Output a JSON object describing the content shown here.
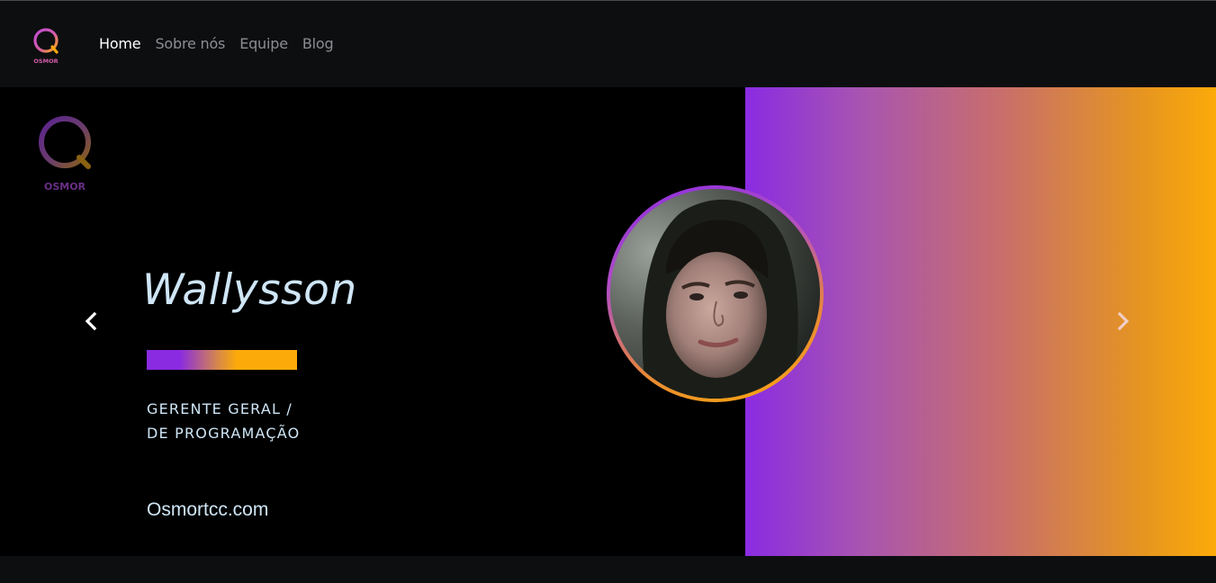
{
  "nav": {
    "logo_text": "OSMOR",
    "links": [
      {
        "label": "Home",
        "active": true
      },
      {
        "label": "Sobre nós",
        "active": false
      },
      {
        "label": "Equipe",
        "active": false
      },
      {
        "label": "Blog",
        "active": false
      }
    ]
  },
  "hero": {
    "logo_text": "OSMOR",
    "member": {
      "name": "Wallysson",
      "role_line1": "GERENTE GERAL /",
      "role_line2": "DE PROGRAMAÇÃO",
      "site": "Osmortcc.com"
    },
    "prev_icon": "chevron-left-icon",
    "next_icon": "chevron-right-icon"
  },
  "colors": {
    "purple": "#8a2be2",
    "orange": "#fcaa0a",
    "text_light": "#cfe6f7",
    "nav_bg": "#0d0e10"
  }
}
